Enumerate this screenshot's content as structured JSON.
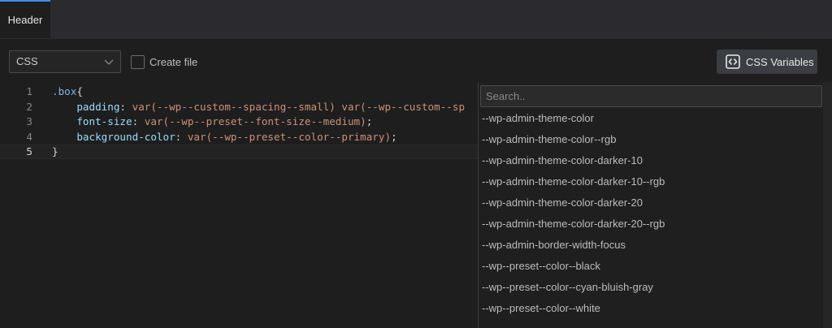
{
  "tabs": [
    {
      "label": "Header"
    }
  ],
  "toolbar": {
    "language": "CSS",
    "create_file_label": "Create file",
    "create_file_checked": false,
    "css_variables_label": "CSS Variables"
  },
  "editor": {
    "current_line": 5,
    "lines": [
      {
        "num": "1",
        "tokens": [
          {
            "t": ".box",
            "k": "sel"
          },
          {
            "t": "{",
            "k": "punc"
          }
        ]
      },
      {
        "num": "2",
        "tokens": [
          {
            "t": "    ",
            "k": "punc"
          },
          {
            "t": "padding",
            "k": "prop"
          },
          {
            "t": ": ",
            "k": "punc"
          },
          {
            "t": "var(--wp--custom--spacing--small) var(--wp--custom--sp",
            "k": "val"
          }
        ]
      },
      {
        "num": "3",
        "tokens": [
          {
            "t": "    ",
            "k": "punc"
          },
          {
            "t": "font-size",
            "k": "prop"
          },
          {
            "t": ": ",
            "k": "punc"
          },
          {
            "t": "var(--wp--preset--font-size--medium)",
            "k": "val"
          },
          {
            "t": ";",
            "k": "punc"
          }
        ]
      },
      {
        "num": "4",
        "tokens": [
          {
            "t": "    ",
            "k": "punc"
          },
          {
            "t": "background-color",
            "k": "prop"
          },
          {
            "t": ": ",
            "k": "punc"
          },
          {
            "t": "var(--wp--preset--color--primary)",
            "k": "val"
          },
          {
            "t": ";",
            "k": "punc"
          }
        ]
      },
      {
        "num": "5",
        "tokens": [
          {
            "t": "}",
            "k": "punc"
          }
        ]
      }
    ]
  },
  "variables_popup": {
    "search_placeholder": "Search..",
    "items": [
      "--wp-admin-theme-color",
      "--wp-admin-theme-color--rgb",
      "--wp-admin-theme-color-darker-10",
      "--wp-admin-theme-color-darker-10--rgb",
      "--wp-admin-theme-color-darker-20",
      "--wp-admin-theme-color-darker-20--rgb",
      "--wp-admin-border-width-focus",
      "--wp--preset--color--black",
      "--wp--preset--color--cyan-bluish-gray",
      "--wp--preset--color--white"
    ]
  },
  "colors": {
    "accent": "#3b8eea",
    "property": "#9cdcfe",
    "value": "#ce9178",
    "selector": "#7fb6e6"
  },
  "icons": [
    "chevron-down-icon",
    "code-brackets-icon"
  ]
}
